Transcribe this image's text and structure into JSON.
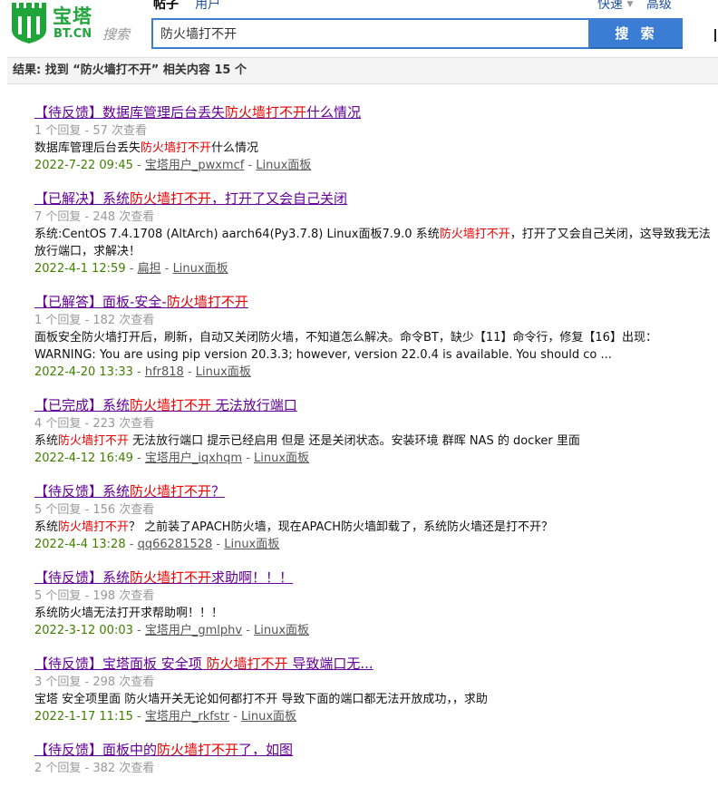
{
  "header": {
    "logo_name": "宝塔",
    "logo_domain": "BT.CN",
    "search_word": "搜索",
    "tabs": [
      {
        "label": "帖子",
        "active": true
      },
      {
        "label": "用户",
        "active": false
      }
    ],
    "quick_label": "快速",
    "advanced_label": "高级",
    "search_value": "防火墙打不开",
    "search_button": "搜 索"
  },
  "result_summary": "结果: 找到 “防火墙打不开” 相关内容 15 个",
  "results": [
    {
      "title": [
        {
          "t": "【待反馈】数据库管理后台丢失",
          "hl": false
        },
        {
          "t": "防火墙打不开",
          "hl": true
        },
        {
          "t": "什么情况",
          "hl": false
        }
      ],
      "stats": "1 个回复 - 57 次查看",
      "summary": [
        {
          "t": "数据库管理后台丢失",
          "hl": false
        },
        {
          "t": "防火墙打不开",
          "hl": true
        },
        {
          "t": "什么情况",
          "hl": false
        }
      ],
      "date": "2022-7-22 09:45",
      "author": "宝塔用户_pwxmcf",
      "forum": "Linux面板"
    },
    {
      "title": [
        {
          "t": "【已解决】系统",
          "hl": false
        },
        {
          "t": "防火墙打不开",
          "hl": true
        },
        {
          "t": "，打开了又会自己关闭",
          "hl": false
        }
      ],
      "stats": "7 个回复 - 248 次查看",
      "summary": [
        {
          "t": "系统:CentOS 7.4.1708 (AltArch) aarch64(Py3.7.8)     Linux面板7.9.0 系统",
          "hl": false
        },
        {
          "t": "防火墙打不开",
          "hl": true
        },
        {
          "t": "，打开了又会自己关闭，这导致我无法放行端口，求解决！",
          "hl": false
        }
      ],
      "date": "2022-4-1 12:59",
      "author": "扁担",
      "forum": "Linux面板"
    },
    {
      "title": [
        {
          "t": "【已解答】面板-安全-",
          "hl": false
        },
        {
          "t": "防火墙打不开",
          "hl": true
        }
      ],
      "stats": "1 个回复 - 182 次查看",
      "summary": [
        {
          "t": "面板安全防火墙打开后，刷新，自动又关闭防火墙，不知道怎么解决。命令BT，缺少【11】命令行，修复【16】出现：WARNING: You are using pip version 20.3.3; however, version 22.0.4 is available. You should co ...",
          "hl": false
        }
      ],
      "date": "2022-4-20 13:33",
      "author": "hfr818",
      "forum": "Linux面板"
    },
    {
      "title": [
        {
          "t": "【已完成】系统",
          "hl": false
        },
        {
          "t": "防火墙打不开",
          "hl": true
        },
        {
          "t": " 无法放行端口",
          "hl": false
        }
      ],
      "stats": "4 个回复 - 223 次查看",
      "summary": [
        {
          "t": "系统",
          "hl": false
        },
        {
          "t": "防火墙打不开",
          "hl": true
        },
        {
          "t": " 无法放行端口 提示已经启用 但是 还是关闭状态。安装环境 群晖 NAS 的 docker 里面",
          "hl": false
        }
      ],
      "date": "2022-4-12 16:49",
      "author": "宝塔用户_iqxhqm",
      "forum": "Linux面板"
    },
    {
      "title": [
        {
          "t": "【待反馈】系统",
          "hl": false
        },
        {
          "t": "防火墙打不开",
          "hl": true
        },
        {
          "t": "？",
          "hl": false
        }
      ],
      "stats": "5 个回复 - 156 次查看",
      "summary": [
        {
          "t": "系统",
          "hl": false
        },
        {
          "t": "防火墙打不开",
          "hl": true
        },
        {
          "t": "？ 之前装了APACH防火墙，现在APACH防火墙卸载了，系统防火墙还是打不开？",
          "hl": false
        }
      ],
      "date": "2022-4-4 13:28",
      "author": "qq66281528",
      "forum": "Linux面板"
    },
    {
      "title": [
        {
          "t": "【待反馈】系统",
          "hl": false
        },
        {
          "t": "防火墙打不开",
          "hl": true
        },
        {
          "t": "求助啊！！！",
          "hl": false
        }
      ],
      "stats": "5 个回复 - 198 次查看",
      "summary": [
        {
          "t": "系统防火墙无法打开求帮助啊！！！",
          "hl": false
        }
      ],
      "date": "2022-3-12 00:03",
      "author": "宝塔用户_gmlphv",
      "forum": "Linux面板"
    },
    {
      "title": [
        {
          "t": "【待反馈】宝塔面板 安全项 ",
          "hl": false
        },
        {
          "t": "防火墙打不开",
          "hl": true
        },
        {
          "t": " 导致端口无...",
          "hl": false
        }
      ],
      "stats": "3 个回复 - 298 次查看",
      "summary": [
        {
          "t": "宝塔 安全项里面 防火墙开关无论如何都打不开 导致下面的端口都无法开放成功，，求助",
          "hl": false
        }
      ],
      "date": "2022-1-17 11:15",
      "author": "宝塔用户_rkfstr",
      "forum": "Linux面板"
    },
    {
      "title": [
        {
          "t": "【待反馈】面板中的",
          "hl": false
        },
        {
          "t": "防火墙打不开",
          "hl": true
        },
        {
          "t": "了，如图",
          "hl": false
        }
      ],
      "stats": "2 个回复 - 382 次查看",
      "summary": [],
      "date": "",
      "author": "",
      "forum": ""
    }
  ]
}
